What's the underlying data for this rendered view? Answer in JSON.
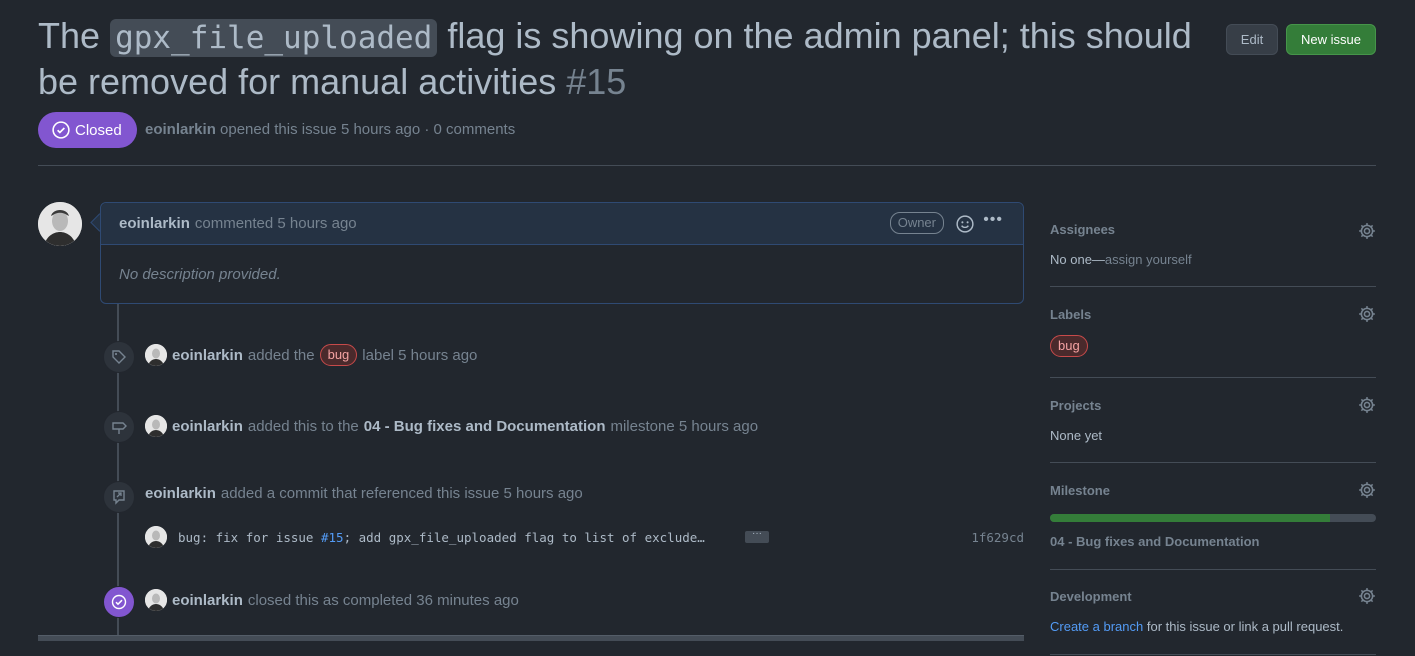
{
  "issue": {
    "title_prefix": "The",
    "title_code": "gpx_file_uploaded",
    "title_suffix": "flag is showing on the admin panel; this should be removed for manual activities",
    "number": "#15",
    "state": "Closed",
    "author": "eoinlarkin",
    "opened_text": "opened this issue 5 hours ago · 0 comments"
  },
  "header_buttons": {
    "edit": "Edit",
    "new_issue": "New issue"
  },
  "comment": {
    "author": "eoinlarkin",
    "time": "commented 5 hours ago",
    "role_badge": "Owner",
    "body": "No description provided."
  },
  "timeline": {
    "label_event": {
      "author": "eoinlarkin",
      "pre": "added the",
      "label": "bug",
      "post": "label 5 hours ago"
    },
    "milestone_event": {
      "author": "eoinlarkin",
      "pre": "added this to the",
      "milestone": "04 - Bug fixes and Documentation",
      "post": "milestone 5 hours ago"
    },
    "commit_event": {
      "author": "eoinlarkin",
      "text": "added a commit that referenced this issue 5 hours ago"
    },
    "commit": {
      "msg_pre": "bug: fix for issue ",
      "msg_ref": "#15",
      "msg_post": "; add gpx_file_uploaded flag to list of exclude…",
      "sha": "1f629cd",
      "ellipsis": "···"
    },
    "close_event": {
      "author": "eoinlarkin",
      "text": "closed this as completed 36 minutes ago"
    }
  },
  "sidebar": {
    "assignees": {
      "title": "Assignees",
      "value": "No one—",
      "link": "assign yourself"
    },
    "labels": {
      "title": "Labels",
      "label": "bug"
    },
    "projects": {
      "title": "Projects",
      "value": "None yet"
    },
    "milestone": {
      "title": "Milestone",
      "name": "04 - Bug fixes and Documentation",
      "progress_percent": 86
    },
    "development": {
      "title": "Development",
      "link": "Create a branch",
      "text": " for this issue or link a pull request."
    }
  },
  "colors": {
    "accent": "#539bf5",
    "closed": "#8256d0",
    "success": "#347d39",
    "bug_label": "#c74a4a"
  }
}
